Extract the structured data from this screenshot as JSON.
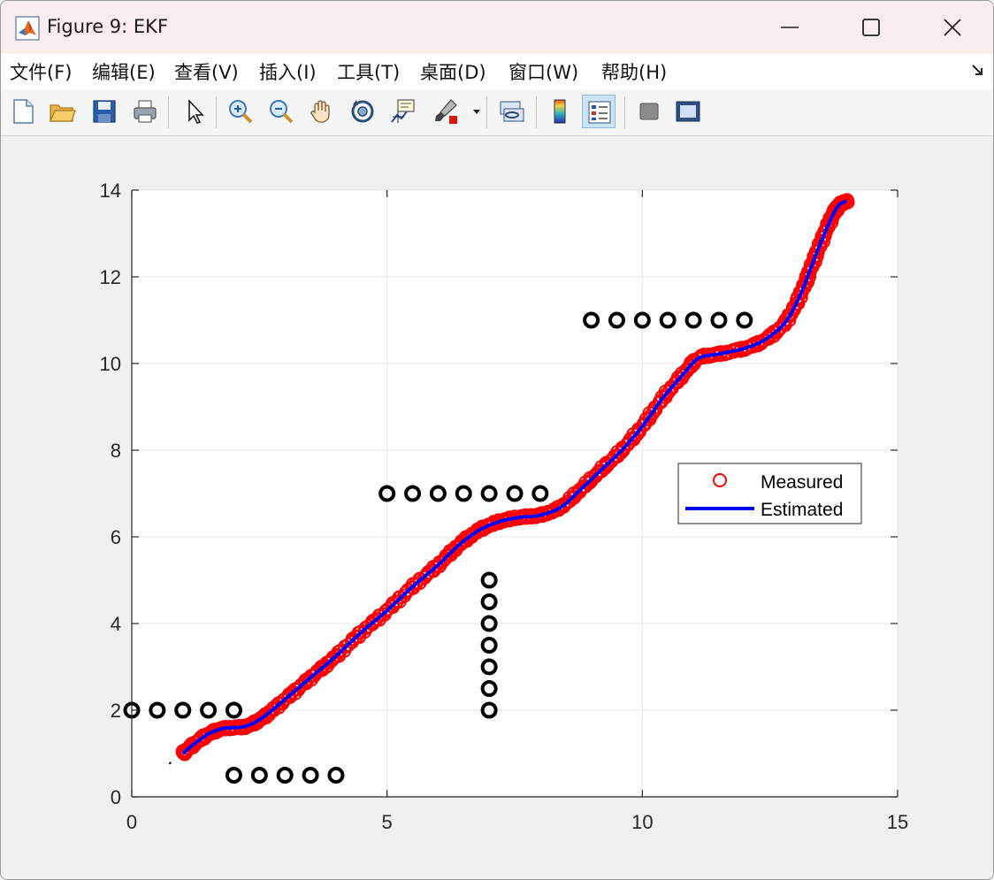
{
  "window": {
    "title": "Figure 9: EKF"
  },
  "menu": {
    "items": [
      "文件(F)",
      "编辑(E)",
      "查看(V)",
      "插入(I)",
      "工具(T)",
      "桌面(D)",
      "窗口(W)",
      "帮助(H)"
    ]
  },
  "toolbar": {
    "icons": [
      "new-file-icon",
      "open-folder-icon",
      "save-icon",
      "print-icon",
      "pointer-icon",
      "zoom-in-icon",
      "zoom-out-icon",
      "pan-hand-icon",
      "rotate-3d-icon",
      "data-cursor-icon",
      "brush-icon",
      "brush-dropdown-icon",
      "link-plot-icon",
      "colorbar-icon",
      "legend-icon",
      "hide-plot-tools-icon",
      "show-plot-tools-icon"
    ]
  },
  "colors": {
    "measured": "#ff0000",
    "estimated": "#0000ff",
    "landmarks": "#000000",
    "grid": "#e6e6e6",
    "axes": "#262626"
  },
  "chart_data": {
    "type": "scatter",
    "xlim": [
      0,
      15
    ],
    "ylim": [
      0,
      14
    ],
    "xticks": [
      0,
      5,
      10,
      15
    ],
    "yticks": [
      0,
      2,
      4,
      6,
      8,
      10,
      12,
      14
    ],
    "grid": true,
    "legend": {
      "placement": "right",
      "entries": [
        "Measured",
        "Estimated"
      ]
    },
    "trajectory_keypoints": {
      "x": [
        1.0,
        1.2,
        1.5,
        1.8,
        2.2,
        2.5,
        2.8,
        3.2,
        3.6,
        4.0,
        4.5,
        5.0,
        5.5,
        6.0,
        6.4,
        6.8,
        7.2,
        7.6,
        8.0,
        8.4,
        8.8,
        9.2,
        9.6,
        10.0,
        10.4,
        10.8,
        11.1,
        11.5,
        12.0,
        12.4,
        12.8,
        13.1,
        13.3,
        13.5,
        13.7,
        13.85,
        14.0
      ],
      "y": [
        1.0,
        1.2,
        1.45,
        1.58,
        1.62,
        1.78,
        2.05,
        2.45,
        2.85,
        3.25,
        3.8,
        4.3,
        4.85,
        5.35,
        5.8,
        6.15,
        6.35,
        6.45,
        6.5,
        6.68,
        7.1,
        7.55,
        8.0,
        8.55,
        9.2,
        9.75,
        10.12,
        10.22,
        10.35,
        10.55,
        10.95,
        11.6,
        12.2,
        12.8,
        13.35,
        13.65,
        13.75
      ]
    },
    "landmarks": {
      "x": [
        0,
        0.5,
        1,
        1.5,
        2,
        2,
        2.5,
        3,
        3.5,
        4,
        5,
        5.5,
        6,
        6.5,
        7,
        7.5,
        8,
        7,
        7,
        7,
        7,
        7,
        7,
        7,
        9,
        9.5,
        10,
        10.5,
        11,
        11.5,
        12
      ],
      "y": [
        2,
        2,
        2,
        2,
        2,
        0.5,
        0.5,
        0.5,
        0.5,
        0.5,
        7,
        7,
        7,
        7,
        7,
        7,
        7,
        2,
        2.5,
        3,
        3.5,
        4,
        4.5,
        5,
        11,
        11,
        11,
        11,
        11,
        11,
        11
      ]
    },
    "start_marker": {
      "x": 0.75,
      "y": 0.78
    }
  }
}
